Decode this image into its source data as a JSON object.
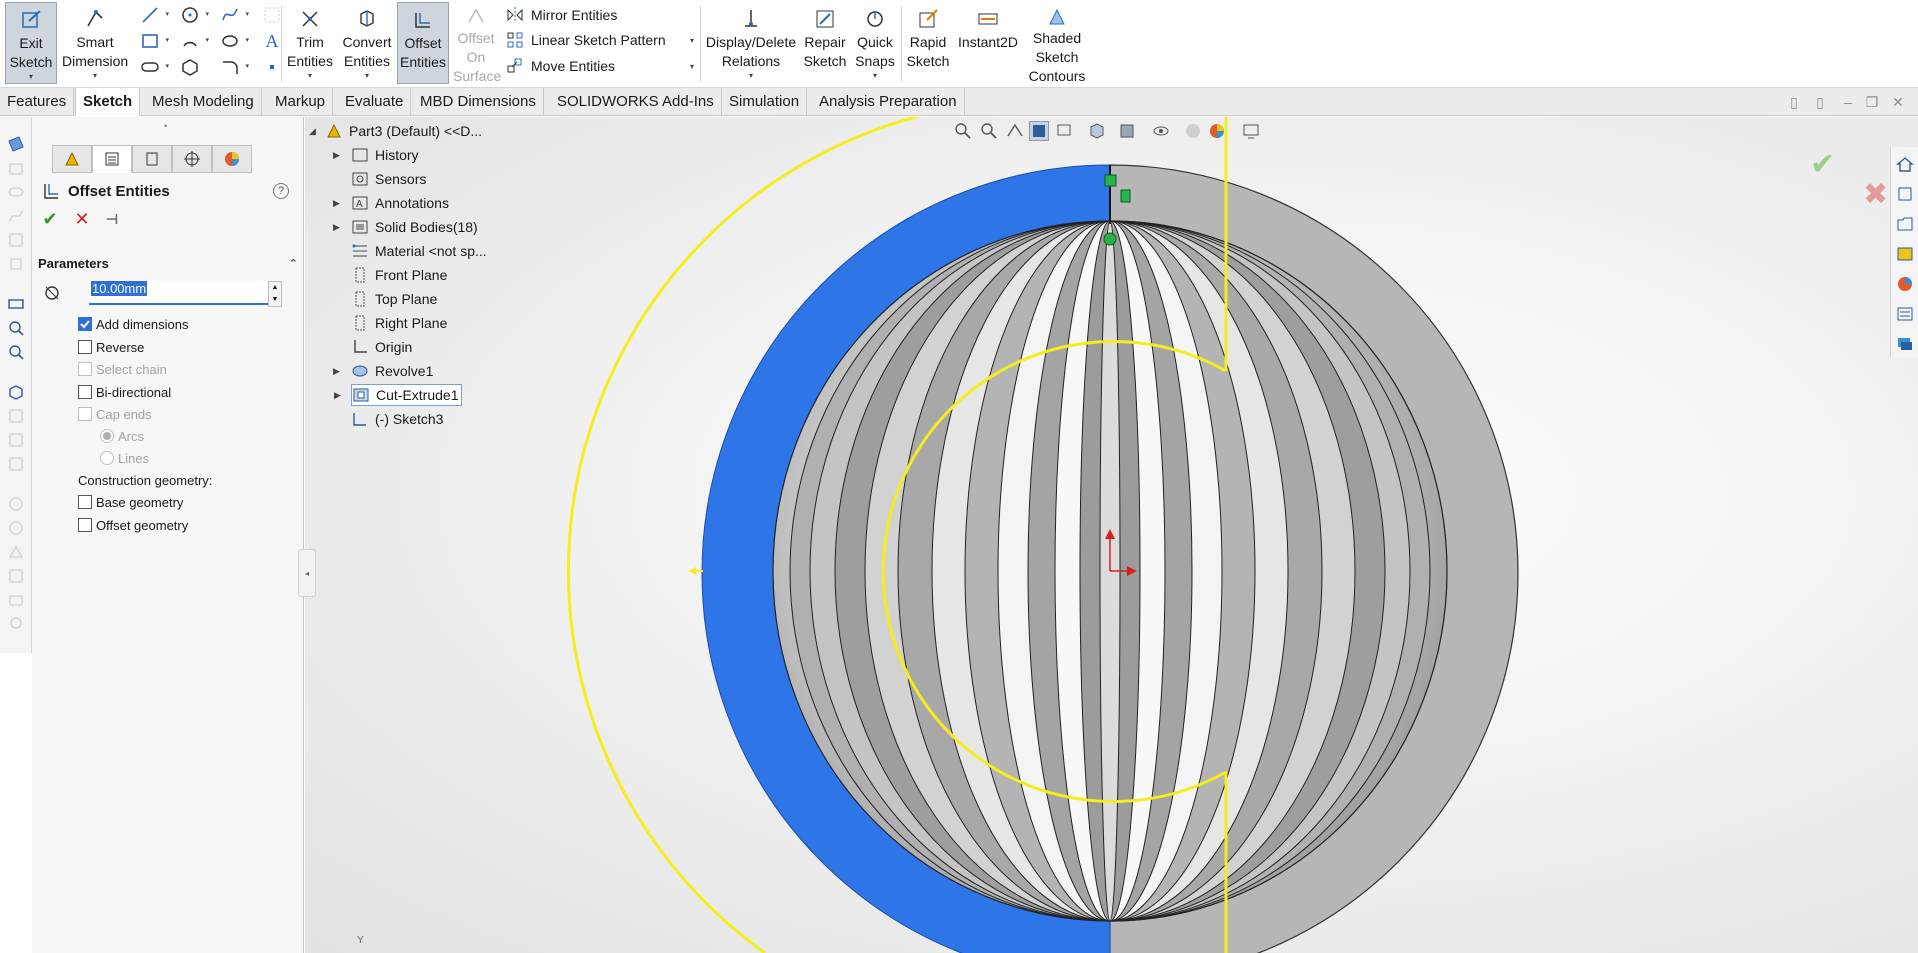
{
  "ribbon": {
    "exit_sketch": "Exit Sketch",
    "smart_dimension": "Smart Dimension",
    "trim_entities": "Trim Entities",
    "convert_entities": "Convert Entities",
    "offset_entities": "Offset Entities",
    "offset_on_surface": "Offset On Surface",
    "mirror_entities": "Mirror Entities",
    "linear_sketch_pattern": "Linear Sketch Pattern",
    "move_entities": "Move Entities",
    "display_delete_relations": "Display/Delete Relations",
    "repair_sketch": "Repair Sketch",
    "quick_snaps": "Quick Snaps",
    "rapid_sketch": "Rapid Sketch",
    "instant2d": "Instant2D",
    "shaded_sketch_contours": "Shaded Sketch Contours"
  },
  "tabs": [
    "Features",
    "Sketch",
    "Mesh Modeling",
    "Markup",
    "Evaluate",
    "MBD Dimensions",
    "SOLIDWORKS Add-Ins",
    "Simulation",
    "Analysis Preparation"
  ],
  "property_manager": {
    "title": "Offset Entities",
    "help": "?",
    "section": "Parameters",
    "distance_value": "10.00mm",
    "options": {
      "add_dimensions": "Add dimensions",
      "reverse": "Reverse",
      "select_chain": "Select chain",
      "bi_directional": "Bi-directional",
      "cap_ends": "Cap ends",
      "arcs": "Arcs",
      "lines": "Lines",
      "construction_geometry": "Construction geometry:",
      "base_geometry": "Base geometry",
      "offset_geometry": "Offset geometry"
    }
  },
  "tree": {
    "root": "Part3 (Default) <<D...",
    "items": [
      "History",
      "Sensors",
      "Annotations",
      "Solid Bodies(18)",
      "Material <not sp...",
      "Front Plane",
      "Top Plane",
      "Right Plane",
      "Origin",
      "Revolve1",
      "Cut-Extrude1",
      "(-) Sketch3"
    ]
  },
  "viewport": {
    "axis_label": "Y"
  },
  "colors": {
    "accent": "#2f6fd6",
    "sketch_yellow": "#f5ee1c",
    "selected_face_blue": "#2e75e8",
    "model_gray": "#b4b4b4"
  }
}
